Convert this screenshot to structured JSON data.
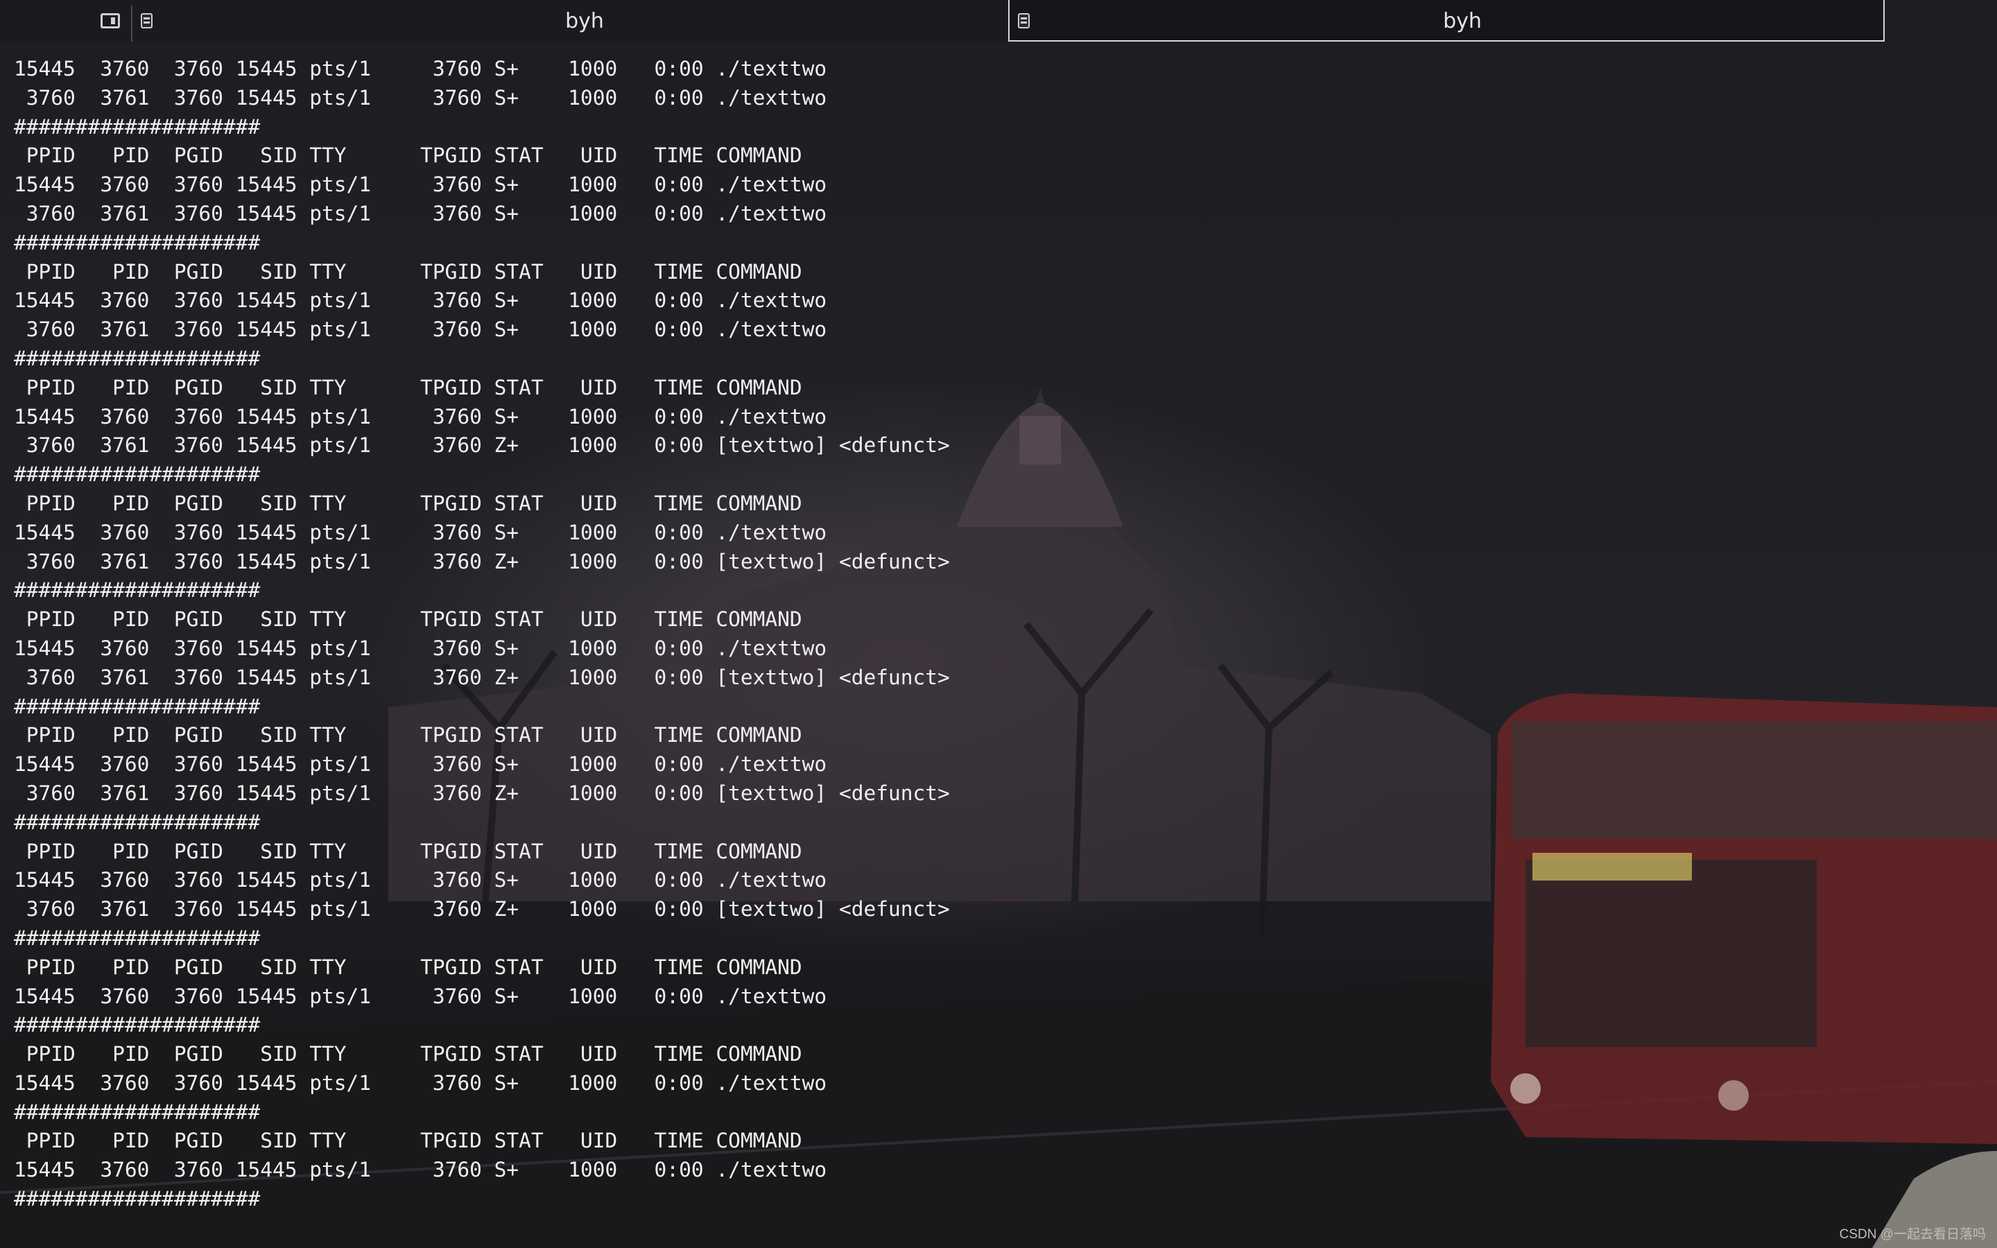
{
  "windows": [
    {
      "title": "byh"
    },
    {
      "title": "byh"
    }
  ],
  "terminal": {
    "lines": [
      "15445  3760  3760 15445 pts/1     3760 S+    1000   0:00 ./texttwo",
      " 3760  3761  3760 15445 pts/1     3760 S+    1000   0:00 ./texttwo",
      "####################",
      " PPID   PID  PGID   SID TTY      TPGID STAT   UID   TIME COMMAND",
      "15445  3760  3760 15445 pts/1     3760 S+    1000   0:00 ./texttwo",
      " 3760  3761  3760 15445 pts/1     3760 S+    1000   0:00 ./texttwo",
      "####################",
      " PPID   PID  PGID   SID TTY      TPGID STAT   UID   TIME COMMAND",
      "15445  3760  3760 15445 pts/1     3760 S+    1000   0:00 ./texttwo",
      " 3760  3761  3760 15445 pts/1     3760 S+    1000   0:00 ./texttwo",
      "####################",
      " PPID   PID  PGID   SID TTY      TPGID STAT   UID   TIME COMMAND",
      "15445  3760  3760 15445 pts/1     3760 S+    1000   0:00 ./texttwo",
      " 3760  3761  3760 15445 pts/1     3760 Z+    1000   0:00 [texttwo] <defunct>",
      "####################",
      " PPID   PID  PGID   SID TTY      TPGID STAT   UID   TIME COMMAND",
      "15445  3760  3760 15445 pts/1     3760 S+    1000   0:00 ./texttwo",
      " 3760  3761  3760 15445 pts/1     3760 Z+    1000   0:00 [texttwo] <defunct>",
      "####################",
      " PPID   PID  PGID   SID TTY      TPGID STAT   UID   TIME COMMAND",
      "15445  3760  3760 15445 pts/1     3760 S+    1000   0:00 ./texttwo",
      " 3760  3761  3760 15445 pts/1     3760 Z+    1000   0:00 [texttwo] <defunct>",
      "####################",
      " PPID   PID  PGID   SID TTY      TPGID STAT   UID   TIME COMMAND",
      "15445  3760  3760 15445 pts/1     3760 S+    1000   0:00 ./texttwo",
      " 3760  3761  3760 15445 pts/1     3760 Z+    1000   0:00 [texttwo] <defunct>",
      "####################",
      " PPID   PID  PGID   SID TTY      TPGID STAT   UID   TIME COMMAND",
      "15445  3760  3760 15445 pts/1     3760 S+    1000   0:00 ./texttwo",
      " 3760  3761  3760 15445 pts/1     3760 Z+    1000   0:00 [texttwo] <defunct>",
      "####################",
      " PPID   PID  PGID   SID TTY      TPGID STAT   UID   TIME COMMAND",
      "15445  3760  3760 15445 pts/1     3760 S+    1000   0:00 ./texttwo",
      "####################",
      " PPID   PID  PGID   SID TTY      TPGID STAT   UID   TIME COMMAND",
      "15445  3760  3760 15445 pts/1     3760 S+    1000   0:00 ./texttwo",
      "####################",
      " PPID   PID  PGID   SID TTY      TPGID STAT   UID   TIME COMMAND",
      "15445  3760  3760 15445 pts/1     3760 S+    1000   0:00 ./texttwo",
      "####################"
    ]
  },
  "watermark": "CSDN @一起去看日落吗",
  "icons": {
    "split": "split-view-icon",
    "terminal": "terminal-icon"
  },
  "colors": {
    "terminal_text": "#f0f0f0",
    "titlebar_bg": "#16161a",
    "active_border": "#d8d8dc"
  }
}
